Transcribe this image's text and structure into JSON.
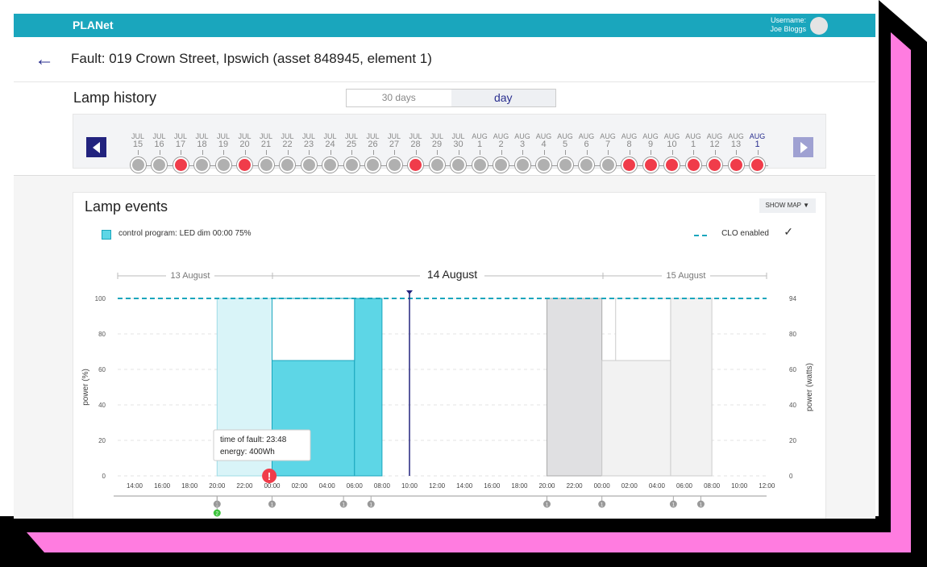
{
  "header": {
    "brand": "PLANet",
    "username_label": "Username:",
    "username": "Joe Bloggs"
  },
  "page": {
    "title": "Fault: 019 Crown Street, Ipswich (asset 848945, element 1)"
  },
  "lamp_history": {
    "title": "Lamp history",
    "toggle": [
      "30 days",
      "day"
    ],
    "selected_toggle": "day",
    "days": [
      {
        "m": "JUL",
        "d": "15",
        "s": "grey"
      },
      {
        "m": "JUL",
        "d": "16",
        "s": "grey"
      },
      {
        "m": "JUL",
        "d": "17",
        "s": "red"
      },
      {
        "m": "JUL",
        "d": "18",
        "s": "grey"
      },
      {
        "m": "JUL",
        "d": "19",
        "s": "grey"
      },
      {
        "m": "JUL",
        "d": "20",
        "s": "red"
      },
      {
        "m": "JUL",
        "d": "21",
        "s": "grey"
      },
      {
        "m": "JUL",
        "d": "22",
        "s": "grey"
      },
      {
        "m": "JUL",
        "d": "23",
        "s": "grey"
      },
      {
        "m": "JUL",
        "d": "24",
        "s": "grey"
      },
      {
        "m": "JUL",
        "d": "25",
        "s": "grey"
      },
      {
        "m": "JUL",
        "d": "26",
        "s": "grey"
      },
      {
        "m": "JUL",
        "d": "27",
        "s": "grey"
      },
      {
        "m": "JUL",
        "d": "28",
        "s": "red"
      },
      {
        "m": "JUL",
        "d": "29",
        "s": "grey"
      },
      {
        "m": "JUL",
        "d": "30",
        "s": "grey"
      },
      {
        "m": "AUG",
        "d": "1",
        "s": "grey"
      },
      {
        "m": "AUG",
        "d": "2",
        "s": "grey"
      },
      {
        "m": "AUG",
        "d": "3",
        "s": "grey"
      },
      {
        "m": "AUG",
        "d": "4",
        "s": "grey"
      },
      {
        "m": "AUG",
        "d": "5",
        "s": "grey"
      },
      {
        "m": "AUG",
        "d": "6",
        "s": "grey"
      },
      {
        "m": "AUG",
        "d": "7",
        "s": "grey"
      },
      {
        "m": "AUG",
        "d": "8",
        "s": "red"
      },
      {
        "m": "AUG",
        "d": "9",
        "s": "red"
      },
      {
        "m": "AUG",
        "d": "10",
        "s": "red"
      },
      {
        "m": "AUG",
        "d": "1",
        "s": "red"
      },
      {
        "m": "AUG",
        "d": "12",
        "s": "red"
      },
      {
        "m": "AUG",
        "d": "13",
        "s": "red"
      },
      {
        "m": "AUG",
        "d": "1",
        "s": "red",
        "selected": true
      }
    ]
  },
  "lamp_events": {
    "title": "Lamp events",
    "show_map": "SHOW MAP ▼",
    "legend_program": "control program: LED dim 00:00 75%",
    "legend_clo": "CLO enabled",
    "date_labels": [
      "13 August",
      "14 August",
      "15 August"
    ],
    "tooltip": [
      "time of fault: 23:48",
      "energy: 400Wh"
    ]
  },
  "colors": {
    "teal": "#1aa6bd",
    "light_teal": "#5dd6e6",
    "navy": "#22237e",
    "red": "#f03c4a",
    "grey_dot": "#b0b0b0"
  },
  "chart_data": {
    "type": "area",
    "y_left": {
      "label": "power (%)",
      "ticks": [
        0,
        20,
        40,
        60,
        80,
        100
      ],
      "ylim": [
        0,
        100
      ]
    },
    "y_right": {
      "label": "power (watts)",
      "ticks": [
        0,
        20,
        40,
        60,
        80,
        94
      ]
    },
    "x_ticks": [
      "14:00",
      "16:00",
      "18:00",
      "20:00",
      "22:00",
      "00:00",
      "02:00",
      "04:00",
      "06:00",
      "08:00",
      "10:00",
      "12:00",
      "14:00",
      "16:00",
      "18:00",
      "20:00",
      "22:00",
      "00:00",
      "02:00",
      "04:00",
      "06:00",
      "08:00",
      "10:00",
      "12:00"
    ],
    "clo_line": 100,
    "blocks": [
      {
        "from": 3,
        "to": 5,
        "value": 100,
        "kind": "on_light"
      },
      {
        "from": 5,
        "to": 8,
        "value": 65,
        "kind": "on_dim"
      },
      {
        "from": 8,
        "to": 9,
        "value": 100,
        "kind": "on_full"
      },
      {
        "from": 15,
        "to": 17,
        "value": 100,
        "kind": "grey"
      },
      {
        "from": 17,
        "to": 19.5,
        "value": 65,
        "kind": "faded"
      },
      {
        "from": 19.5,
        "to": 21,
        "value": 100,
        "kind": "faded"
      }
    ],
    "now_marker": 10,
    "fault_marker": 4.9,
    "events": [
      {
        "x": 3,
        "count": "1"
      },
      {
        "x": 3,
        "count": "2",
        "ok": true
      },
      {
        "x": 5,
        "count": "1"
      },
      {
        "x": 7.6,
        "count": "1"
      },
      {
        "x": 8.6,
        "count": "1"
      },
      {
        "x": 15,
        "count": "1"
      },
      {
        "x": 17,
        "count": "1"
      },
      {
        "x": 19.6,
        "count": "1"
      },
      {
        "x": 20.6,
        "count": "1"
      }
    ]
  }
}
